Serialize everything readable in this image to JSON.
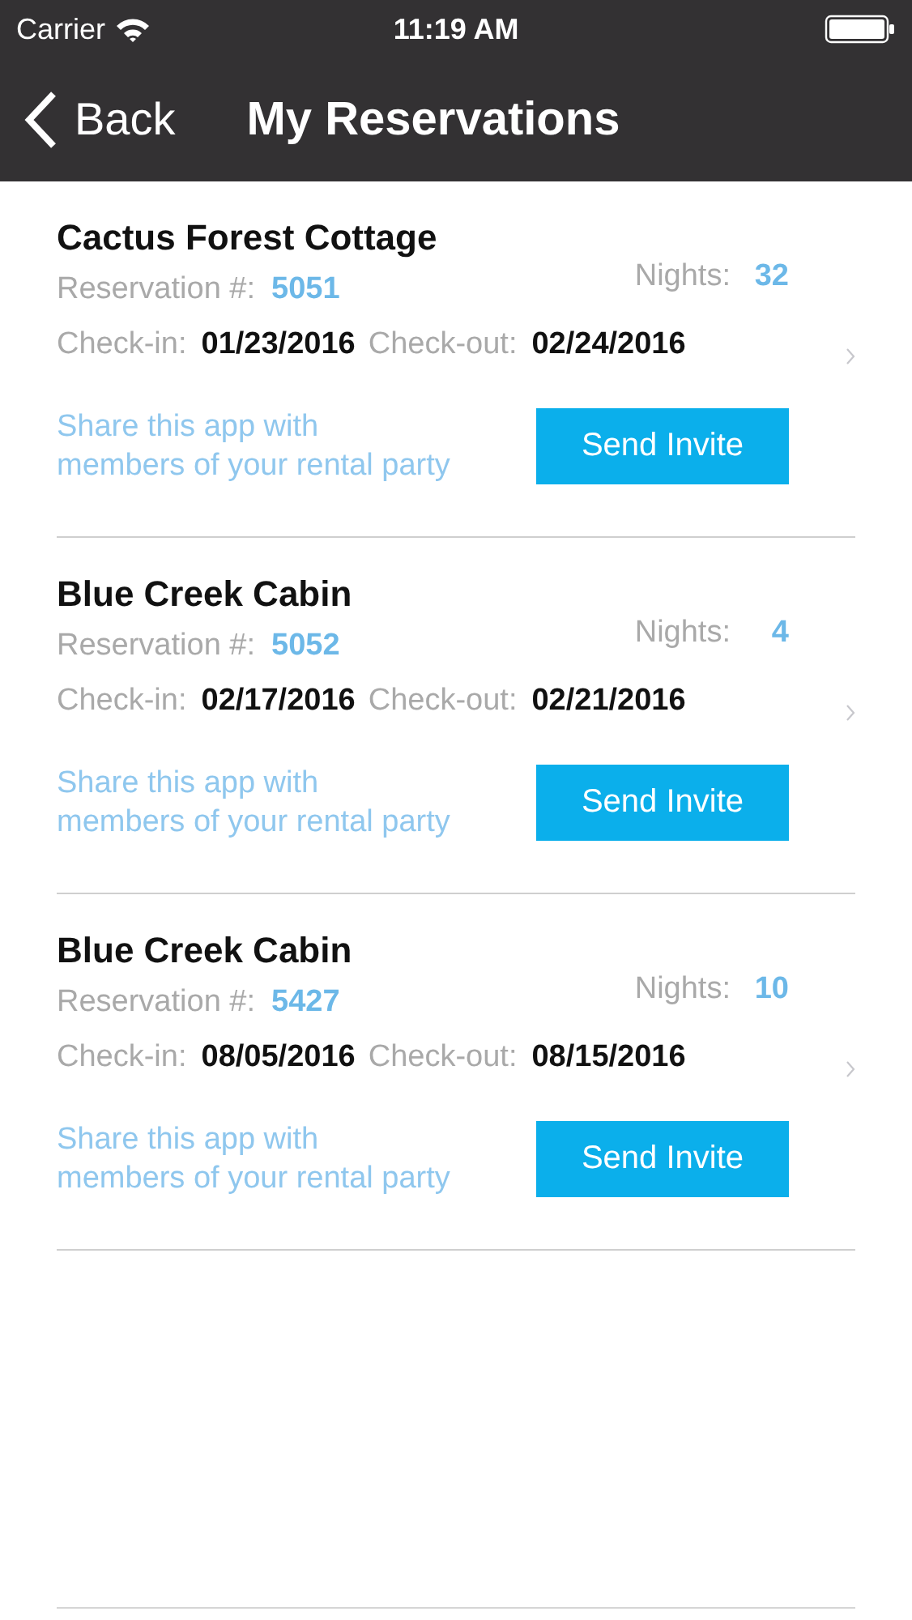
{
  "status_bar": {
    "carrier": "Carrier",
    "time": "11:19 AM"
  },
  "nav": {
    "back": "Back",
    "title": "My Reservations"
  },
  "reservations": [
    {
      "name": "Cactus Forest Cottage",
      "reservation_label": "Reservation #:",
      "reservation_number": "5051",
      "nights_label": "Nights:",
      "nights": "32",
      "checkin_label": "Check-in:",
      "checkin": "01/23/2016",
      "checkout_label": "Check-out:",
      "checkout": "02/24/2016",
      "share_text": "Share this app with\nmembers of your rental party",
      "button": "Send Invite"
    },
    {
      "name": "Blue Creek Cabin",
      "reservation_label": "Reservation #:",
      "reservation_number": "5052",
      "nights_label": "Nights:",
      "nights": "4",
      "checkin_label": "Check-in:",
      "checkin": "02/17/2016",
      "checkout_label": "Check-out:",
      "checkout": "02/21/2016",
      "share_text": "Share this app with\nmembers of your rental party",
      "button": "Send Invite"
    },
    {
      "name": "Blue Creek Cabin",
      "reservation_label": "Reservation #:",
      "reservation_number": "5427",
      "nights_label": "Nights:",
      "nights": "10",
      "checkin_label": "Check-in:",
      "checkin": "08/05/2016",
      "checkout_label": "Check-out:",
      "checkout": "08/15/2016",
      "share_text": "Share this app with\nmembers of your rental party",
      "button": "Send Invite"
    }
  ]
}
